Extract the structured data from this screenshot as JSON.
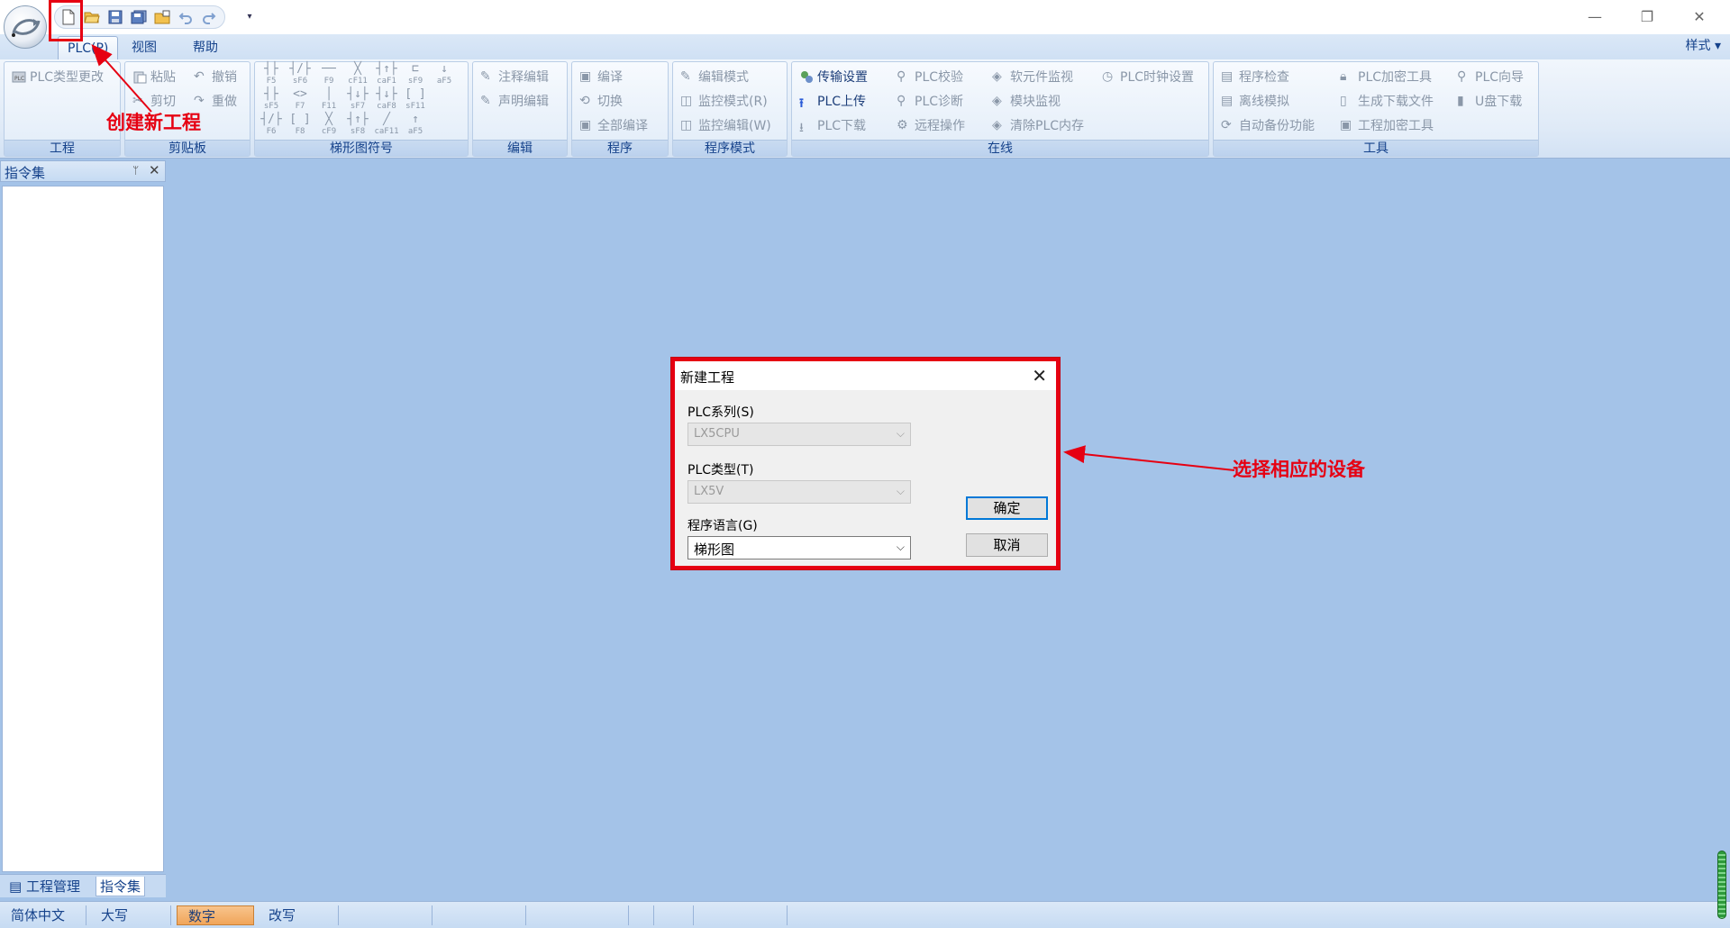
{
  "quick_access": {
    "icons": [
      "new-file-icon",
      "open-folder-icon",
      "save-icon",
      "save-all-icon",
      "open-project-icon",
      "undo-icon",
      "redo-icon"
    ],
    "more": "▾"
  },
  "tabs": [
    {
      "label": "PLC(P)",
      "active": true
    },
    {
      "label": "视图",
      "active": false
    },
    {
      "label": "帮助",
      "active": false
    }
  ],
  "style_menu": "样式 ▾",
  "ribbon": {
    "project": {
      "label": "工程",
      "items": [
        "PLC类型更改"
      ]
    },
    "clipboard": {
      "label": "剪贴板",
      "items": [
        "粘贴",
        "撤销",
        "剪切",
        "重做"
      ]
    },
    "ladder": {
      "label": "梯形图符号",
      "symbols": [
        "F5",
        "sF6",
        "F9",
        "cF11",
        "caF1",
        "sF9",
        "aF5",
        "sF5",
        "F7",
        "F11",
        "sF7",
        "caF8",
        "sF11",
        "F6",
        "F8",
        "cF9",
        "sF8",
        "caF11",
        "aF5"
      ]
    },
    "edit": {
      "label": "编辑",
      "items": [
        "注释编辑",
        "声明编辑"
      ]
    },
    "program": {
      "label": "程序",
      "items": [
        "编译",
        "切换",
        "全部编译"
      ]
    },
    "program_mode": {
      "label": "程序模式",
      "items": [
        "编辑模式",
        "监控模式(R)",
        "监控编辑(W)"
      ]
    },
    "online": {
      "label": "在线",
      "items": [
        "传输设置",
        "PLC上传",
        "PLC下载",
        "PLC校验",
        "PLC诊断",
        "远程操作",
        "软元件监视",
        "模块监视",
        "清除PLC内存",
        "PLC时钟设置"
      ]
    },
    "tools": {
      "label": "工具",
      "items": [
        "程序检查",
        "离线模拟",
        "自动备份功能",
        "PLC加密工具",
        "生成下载文件",
        "工程加密工具",
        "PLC向导",
        "U盘下载"
      ]
    }
  },
  "annotations": {
    "new_project": "创建新工程",
    "select_device": "选择相应的设备",
    "color": "#e60012"
  },
  "side_panel": {
    "title": "指令集",
    "pin": "ᛘ",
    "close": "✕",
    "tabs": [
      "工程管理",
      "指令集"
    ]
  },
  "dialog": {
    "title": "新建工程",
    "close": "✕",
    "plc_series_label": "PLC系列(S)",
    "plc_series_value": "LX5CPU",
    "plc_type_label": "PLC类型(T)",
    "plc_type_value": "LX5V",
    "language_label": "程序语言(G)",
    "language_value": "梯形图",
    "ok": "确定",
    "cancel": "取消"
  },
  "status_bar": [
    "简体中文",
    "大写",
    "数字",
    "改写"
  ]
}
